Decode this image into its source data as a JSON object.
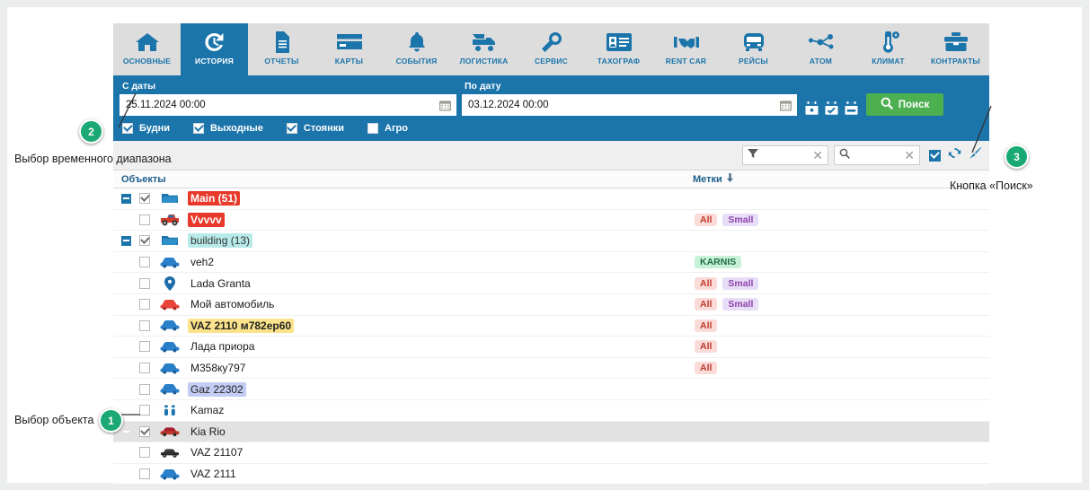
{
  "nav": {
    "tabs": [
      {
        "label": "ОСНОВНЫЕ",
        "icon": "home-icon",
        "active": false
      },
      {
        "label": "ИСТОРИЯ",
        "icon": "history-clock-icon",
        "active": true
      },
      {
        "label": "ОТЧЕТЫ",
        "icon": "document-icon",
        "active": false
      },
      {
        "label": "КАРТЫ",
        "icon": "card-icon",
        "active": false
      },
      {
        "label": "СОБЫТИЯ",
        "icon": "bell-icon",
        "active": false
      },
      {
        "label": "ЛОГИСТИКА",
        "icon": "truck-icon",
        "active": false
      },
      {
        "label": "СЕРВИС",
        "icon": "wrench-icon",
        "active": false
      },
      {
        "label": "ТАХОГРАФ",
        "icon": "id-card-icon",
        "active": false
      },
      {
        "label": "RENT CAR",
        "icon": "handshake-icon",
        "active": false
      },
      {
        "label": "РЕЙСЫ",
        "icon": "bus-icon",
        "active": false
      },
      {
        "label": "АТОМ",
        "icon": "atom-nodes-icon",
        "active": false
      },
      {
        "label": "КЛИМАТ",
        "icon": "thermometer-icon",
        "active": false
      },
      {
        "label": "КОНТРАКТЫ",
        "icon": "briefcase-icon",
        "active": false
      }
    ]
  },
  "filter": {
    "date_from_label": "С даты",
    "date_from_value": "25.11.2024  00:00",
    "date_to_label": "По дату",
    "date_to_value": "03.12.2024  00:00",
    "quick_buttons": [
      "calendar-day-icon",
      "calendar-check-icon",
      "calendar-range-icon"
    ],
    "search_button": "Поиск",
    "checkboxes": [
      {
        "label": "Будни",
        "checked": true
      },
      {
        "label": "Выходные",
        "checked": true
      },
      {
        "label": "Стоянки",
        "checked": true
      },
      {
        "label": "Агро",
        "checked": false
      }
    ]
  },
  "grid_toolbar": {
    "filter_placeholder": "",
    "search_placeholder": "",
    "icons": [
      "select-all-checkbox",
      "refresh-icon",
      "clear-brush-icon"
    ]
  },
  "table": {
    "columns": {
      "objects": "Объекты",
      "tags": "Метки"
    },
    "sort_indicator": "sort-down-arrow-icon",
    "rows": [
      {
        "type": "group",
        "expander": true,
        "checked": true,
        "icon": "folder-icon",
        "name": "Main (51)",
        "highlight": "red",
        "tags": [],
        "selected": false
      },
      {
        "type": "item",
        "expander": false,
        "checked": false,
        "icon": "pickup-truck-icon",
        "name": "Vvvvv",
        "highlight": "red",
        "tags": [
          "All",
          "Small"
        ],
        "selected": false
      },
      {
        "type": "group",
        "expander": true,
        "checked": true,
        "icon": "folder-icon",
        "name": "building (13)",
        "highlight": "teal",
        "tags": [],
        "selected": false
      },
      {
        "type": "item",
        "expander": false,
        "checked": false,
        "icon": "car-blue-icon",
        "name": "veh2",
        "highlight": "none",
        "tags": [
          "KARNIS"
        ],
        "selected": false
      },
      {
        "type": "item",
        "expander": false,
        "checked": false,
        "icon": "map-pin-icon",
        "name": "Lada Granta",
        "highlight": "none",
        "tags": [
          "All",
          "Small"
        ],
        "selected": false
      },
      {
        "type": "item",
        "expander": false,
        "checked": false,
        "icon": "car-red-icon",
        "name": "Мой автомобиль",
        "highlight": "none",
        "tags": [
          "All",
          "Small"
        ],
        "selected": false
      },
      {
        "type": "item",
        "expander": false,
        "checked": false,
        "icon": "car-blue-icon",
        "name": "VAZ 2110 м782ер60",
        "highlight": "yellow",
        "tags": [
          "All"
        ],
        "selected": false
      },
      {
        "type": "item",
        "expander": false,
        "checked": false,
        "icon": "car-blue-icon",
        "name": "Лада приора",
        "highlight": "none",
        "tags": [
          "All"
        ],
        "selected": false
      },
      {
        "type": "item",
        "expander": false,
        "checked": false,
        "icon": "car-blue-icon",
        "name": "M358ку797",
        "highlight": "none",
        "tags": [
          "All"
        ],
        "selected": false
      },
      {
        "type": "item",
        "expander": false,
        "checked": false,
        "icon": "car-blue-icon",
        "name": "Gaz 22302",
        "highlight": "blue",
        "tags": [],
        "selected": false
      },
      {
        "type": "item",
        "expander": false,
        "checked": false,
        "icon": "footprints-icon",
        "name": "Kamaz",
        "highlight": "none",
        "tags": [],
        "selected": false
      },
      {
        "type": "item",
        "expander": false,
        "checked": true,
        "icon": "car-darkred-icon",
        "name": "Kia Rio",
        "highlight": "none",
        "tags": [],
        "selected": true
      },
      {
        "type": "item",
        "expander": false,
        "checked": false,
        "icon": "car-black-icon",
        "name": "VAZ 21107",
        "highlight": "none",
        "tags": [],
        "selected": false
      },
      {
        "type": "item",
        "expander": false,
        "checked": false,
        "icon": "car-blue-icon",
        "name": "VAZ 2111",
        "highlight": "none",
        "tags": [],
        "selected": false
      }
    ]
  },
  "annotations": [
    {
      "number": "1",
      "label": "Выбор объекта"
    },
    {
      "number": "2",
      "label": "Выбор временного диапазона"
    },
    {
      "number": "3",
      "label": "Кнопка «Поиск»"
    }
  ],
  "colors": {
    "brand_blue": "#1b75ab",
    "search_green": "#4caf50",
    "badge_green": "#1aa874",
    "tabbar_gray": "#dddddd"
  }
}
